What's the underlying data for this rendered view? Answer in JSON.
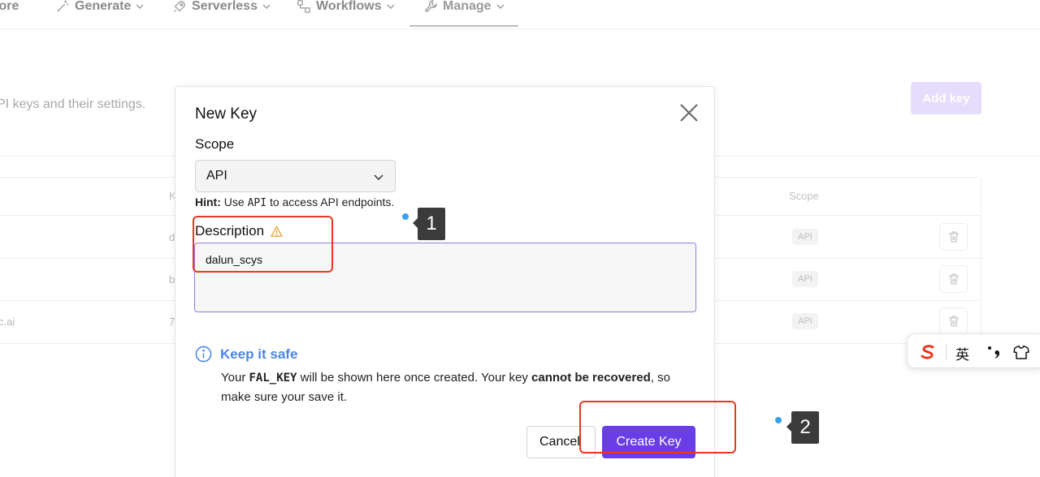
{
  "nav": {
    "items": [
      {
        "label": "lore",
        "icon": "compass-icon"
      },
      {
        "label": "Generate",
        "icon": "magic-wand-icon"
      },
      {
        "label": "Serverless",
        "icon": "rocket-icon"
      },
      {
        "label": "Workflows",
        "icon": "workflow-icon"
      },
      {
        "label": "Manage",
        "icon": "wrench-icon"
      }
    ]
  },
  "page": {
    "subtitle": "PI keys and their settings.",
    "add_key_label": "Add key"
  },
  "table": {
    "headers": {
      "key": "K",
      "scope": "Scope"
    },
    "rows": [
      {
        "name": "",
        "key": "d",
        "scope": "API"
      },
      {
        "name": "",
        "key": "b",
        "scope": "API"
      },
      {
        "name": "c.ai",
        "key": "7",
        "scope": "API"
      }
    ]
  },
  "modal": {
    "title": "New Key",
    "scope_label": "Scope",
    "scope_value": "API",
    "hint_bold": "Hint:",
    "hint_pre": " Use ",
    "hint_code": "API",
    "hint_post": " to access API endpoints.",
    "description_label": "Description",
    "description_value": "dalun_scys",
    "info_title": "Keep it safe",
    "info_1": "Your ",
    "info_code": "FAL_KEY",
    "info_2": " will be shown here once created. Your key ",
    "info_bold": "cannot be recovered",
    "info_3": ", so make sure your save it.",
    "cancel_label": "Cancel",
    "create_label": "Create Key"
  },
  "markers": {
    "one": "1",
    "two": "2"
  },
  "ime": {
    "lang": "英"
  },
  "colors": {
    "accent": "#6a3ee6",
    "info": "#4a86e8",
    "annotation": "#e8381e",
    "warning": "#e8a23a"
  }
}
